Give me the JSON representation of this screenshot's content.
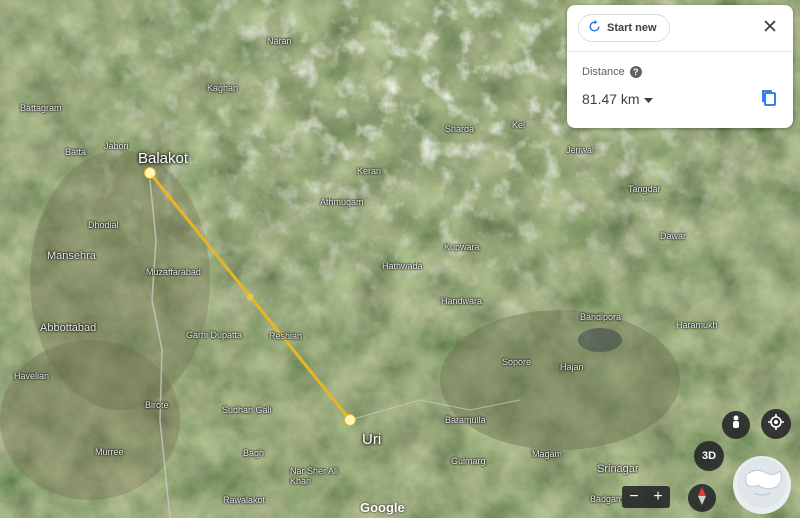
{
  "panel": {
    "start_new_label": "Start new",
    "distance_label": "Distance",
    "distance_value": "81.47 km",
    "help_glyph": "?"
  },
  "map": {
    "markers": {
      "start": "Balakot",
      "end": "Uri"
    },
    "places": {
      "battagram": "Battagram",
      "batta": "Batta",
      "jabori": "Jabori",
      "kaghan": "Kaghan",
      "naran": "Naran",
      "sharda": "Sharda",
      "keran": "Keran",
      "athmuqam": "Athmuqam",
      "kupwara": "Kupwara",
      "hathwada": "Hathwada",
      "handwara": "Handwara",
      "dhodial": "Dhodial",
      "mansehra": "Mansehra",
      "muzaffarabad": "Muzaffarabad",
      "abbottabad": "Abbottabad",
      "garhi_dupatta": "Garhi Dupatta",
      "reshian": "Reshian",
      "havelian": "Havelian",
      "birote": "Birote",
      "sudhan_gali": "Sudhan Gali",
      "murree": "Murree",
      "bagh": "Bagh",
      "nar_sher_ali_khan": "Nar Sher Ali Khan",
      "rawalakot": "Rawalakot",
      "baramulla": "Baramulla",
      "sopore": "Sopore",
      "hajan": "Hajan",
      "bandipora": "Bandipora",
      "magam": "Magam",
      "srinagar": "Srinagar",
      "gulmarg": "Gulmarg",
      "badgam": "Badgam",
      "jenwal": "Jenwal",
      "kel": "Kel",
      "tangdar": "Tangdar",
      "dawar": "Dawar",
      "haramukh": "Haramukh"
    },
    "attribution": "Google",
    "colors": {
      "measure_line": "#e8b624",
      "marker": "#fff6b8"
    }
  },
  "controls": {
    "three_d_label": "3D",
    "zoom_out": "−",
    "zoom_in": "+"
  }
}
